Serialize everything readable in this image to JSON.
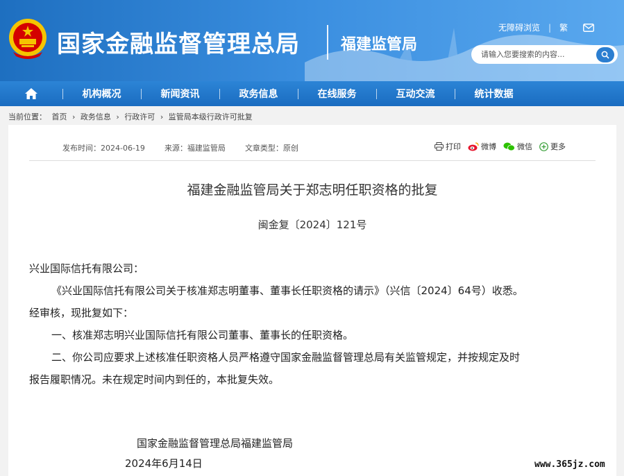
{
  "header": {
    "site_title": "国家金融监督管理总局",
    "sub_title": "福建监管局",
    "links": {
      "accessible": "无障碍浏览",
      "traditional": "繁"
    },
    "search_placeholder": "请输入您要搜索的内容..."
  },
  "nav": {
    "items": [
      "机构概况",
      "新闻资讯",
      "政务信息",
      "在线服务",
      "互动交流",
      "统计数据"
    ]
  },
  "breadcrumb": {
    "label": "当前位置：",
    "items": [
      "首页",
      "政务信息",
      "行政许可",
      "监管局本级行政许可批复"
    ],
    "sep": "›"
  },
  "article": {
    "publish_date": "发布时间：2024-06-19",
    "source": "来源：福建监管局",
    "type": "文章类型：原创",
    "share": {
      "print": "打印",
      "weibo": "微博",
      "wechat": "微信",
      "more": "更多"
    },
    "title": "福建金融监管局关于郑志明任职资格的批复",
    "doc_no": "闽金复〔2024〕121号",
    "addressee": "兴业国际信托有限公司：",
    "p1a": "《兴业国际信托有限公司关于核准郑志明董事、董事长任职资格的请示》（兴信〔2024〕64号）收悉。",
    "p1b": "经审核，现批复如下：",
    "p2": "一、核准郑志明兴业国际信托有限公司董事、董事长的任职资格。",
    "p3a": "二、你公司应要求上述核准任职资格人员严格遵守国家金融监督管理总局有关监管规定，并按规定及时",
    "p3b": "报告履职情况。未在规定时间内到任的，本批复失效。",
    "signature": "国家金融监督管理总局福建监管局",
    "date": "2024年6月14日"
  },
  "watermark": "www.365jz.com",
  "colors": {
    "header": "#1e6fc0",
    "nav": "#1a6cc0",
    "accent": "#d40000"
  }
}
